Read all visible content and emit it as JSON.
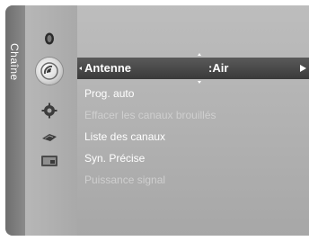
{
  "category": {
    "label": "Chaîne"
  },
  "sidebar": {
    "icons": [
      {
        "name": "picture-icon",
        "selected": false
      },
      {
        "name": "channel-icon",
        "selected": true
      },
      {
        "name": "setup-icon",
        "selected": false
      },
      {
        "name": "input-icon",
        "selected": false
      },
      {
        "name": "application-icon",
        "selected": false
      }
    ]
  },
  "menu": {
    "selected": {
      "label": "Antenne",
      "value": ":Air"
    },
    "items": [
      {
        "label": "Prog. auto",
        "enabled": true
      },
      {
        "label": "Effacer les canaux brouillés",
        "enabled": false
      },
      {
        "label": "Liste des canaux",
        "enabled": true
      },
      {
        "label": "Syn. Précise",
        "enabled": true
      },
      {
        "label": "Puissance signal",
        "enabled": false
      }
    ]
  },
  "colors": {
    "highlight": "#3a3a3a",
    "text": "#ffffff",
    "disabled_text": "#cfcfcf"
  }
}
